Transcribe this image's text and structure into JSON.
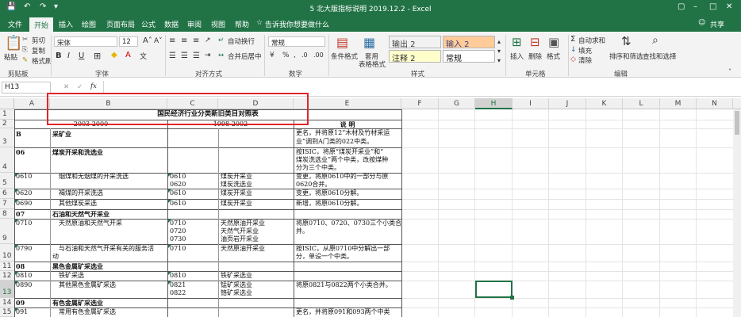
{
  "window": {
    "title": "5 北大版指标说明 2019.12.2  -  Excel",
    "share": "共享"
  },
  "tabs": [
    "文件",
    "开始",
    "插入",
    "绘图",
    "页面布局",
    "公式",
    "数据",
    "审阅",
    "视图",
    "帮助",
    "告诉我你想要做什么"
  ],
  "ribbon": {
    "paste": "粘贴",
    "cut": "剪切",
    "copy": "复制",
    "format_painter": "格式刷",
    "clipboard_label": "剪贴板",
    "font_name": "宋体",
    "font_size": "12",
    "font_label": "字体",
    "wrap_text": "自动换行",
    "merge_center": "合并后居中",
    "align_label": "对齐方式",
    "number_format": "常规",
    "number_label": "数字",
    "cond_format": "条件格式",
    "table_format_1": "套用",
    "table_format_2": "表格格式",
    "styles": [
      "输出 2",
      "输入 2",
      "注释 2",
      "常规"
    ],
    "styles_label": "样式",
    "insert": "插入",
    "delete": "删除",
    "format": "格式",
    "cells_label": "单元格",
    "autosum": "自动求和",
    "fill": "填充",
    "clear": "清除",
    "sort_filter": "排序和筛选",
    "find_select": "查找和选择",
    "editing_label": "编辑",
    "bold": "B",
    "italic": "I",
    "underline": "U"
  },
  "formula_bar": {
    "name_box": "H13",
    "fx": "fx",
    "value": ""
  },
  "columns": [
    "A",
    "B",
    "C",
    "D",
    "E",
    "F",
    "G",
    "H",
    "I",
    "J",
    "K",
    "L",
    "M",
    "N"
  ],
  "selected_column": "H",
  "rows": [
    "1",
    "2",
    "3",
    "4",
    "5",
    "6",
    "7",
    "8",
    "9",
    "10",
    "11",
    "12",
    "13",
    "14",
    "15"
  ],
  "sheet": {
    "title": "国民经济行业分类新旧类目对照表",
    "header_2003": "2003-2000",
    "header_1998": "1998-2002",
    "header_explain": "说         明",
    "rows": [
      {
        "a": "B",
        "b": "采矿业",
        "c": "",
        "d": "",
        "e1": "更名，并将原12“木材及竹材采运",
        "e2": "业”调到A门类的022中类。"
      },
      {
        "a": "06",
        "b": "煤炭开采和洗选业",
        "c": "",
        "d": "",
        "e1": "按ISIC，将原“煤炭开采业”和“",
        "e2": "煤炭洗选业”两个中类，改按煤种",
        "e3": "分为三个中类。"
      },
      {
        "a": "0610",
        "b": "烟煤和无烟煤的开采洗选",
        "c1": "0610",
        "c2": "0620",
        "d1": "煤炭开采业",
        "d2": "煤炭洗选业",
        "e1": "变更，将原0610中的一部分与原",
        "e2": "0620合并。"
      },
      {
        "a": "0620",
        "b": "褐煤的开采洗选",
        "c1": "0610",
        "d1": "煤炭开采业",
        "e1": "变更，将原0610分解。"
      },
      {
        "a": "0690",
        "b": "其他煤炭采选",
        "c1": "0610",
        "d1": "煤炭开采业",
        "e1": "新增，将原0610分解。"
      },
      {
        "a": "07",
        "b": "石油和天然气开采业"
      },
      {
        "a": "0710",
        "b": "天然原油和天然气开采",
        "c1": "0710",
        "c2": "0720",
        "c3": "0730",
        "d1": "天然原油开采业",
        "d2": "天然气开采业",
        "d3": "油页岩开采业",
        "e1": "将原0710、0720、0730三个小类合",
        "e2": "并。"
      },
      {
        "a": "0790",
        "b1": "与石油和天然气开采有关的服务活",
        "b2": "动",
        "c1": "0710",
        "d1": "天然原油开采业",
        "e1": "按ISIC，从原0710中分解出一部",
        "e2": "分，单设一个中类。"
      },
      {
        "a": "08",
        "b": "黑色金属矿采选业"
      },
      {
        "a": "0810",
        "b": "铁矿采选",
        "c1": "0810",
        "d1": "铁矿采选业"
      },
      {
        "a": "0890",
        "b": "其他黑色金属矿采选",
        "c1": "0821",
        "c2": "0822",
        "d1": "锰矿采选业",
        "d2": "铬矿采选业",
        "e1": "将原0821与0822两个小类合并。"
      },
      {
        "a": "09",
        "b": "有色金属矿采选业"
      },
      {
        "a": "091",
        "b": "常用有色金属矿采选",
        "e1": "更名，并将原091和093两个中类"
      }
    ]
  },
  "colors": {
    "excel_green": "#217346",
    "annotation_red": "#e0262a"
  }
}
